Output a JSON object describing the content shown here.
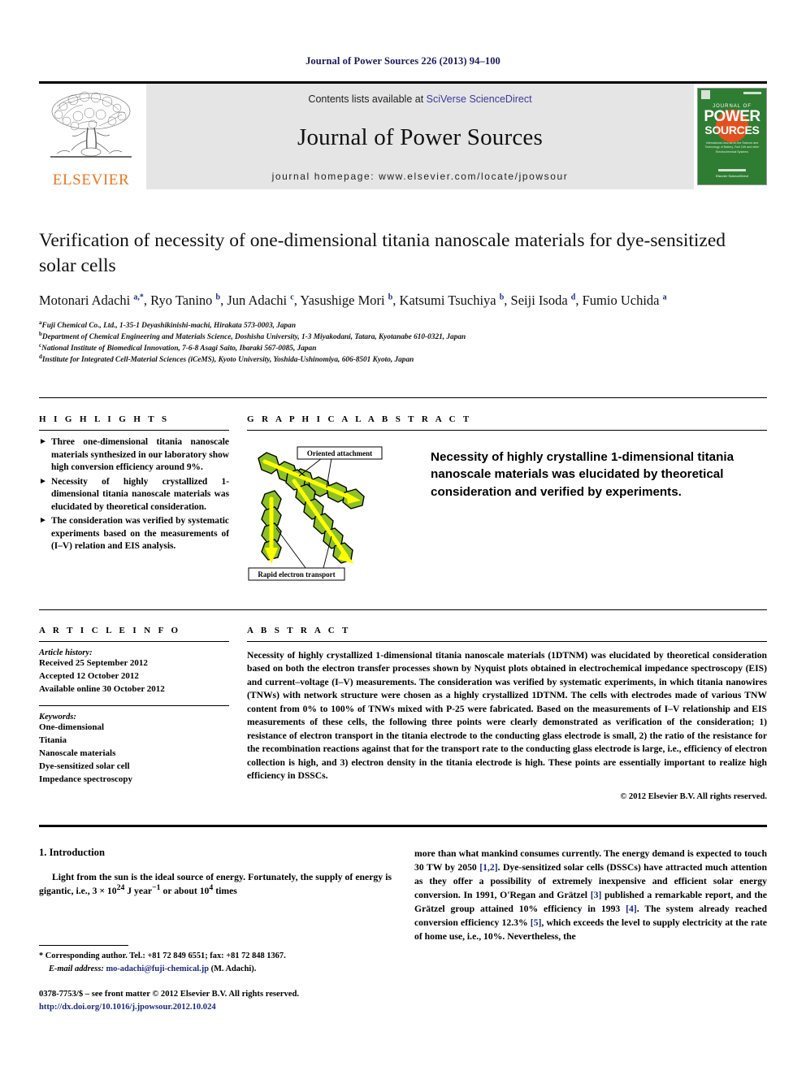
{
  "running_head": "Journal of Power Sources 226 (2013) 94–100",
  "masthead": {
    "publisher_name": "ELSEVIER",
    "contents_prefix": "Contents lists available at ",
    "contents_link": "SciVerse ScienceDirect",
    "journal_title": "Journal of Power Sources",
    "homepage": "journal homepage: www.elsevier.com/locate/jpowsour",
    "cover": {
      "line_journal_of": "JOURNAL OF",
      "line_power": "POWER",
      "line_sources": "SOURCES",
      "subtitle": "International Journal on the Science and Technology of Battery, Fuel Cell and other Electrochemical Systems",
      "footer": "Elsevier ScienceDirect"
    }
  },
  "article": {
    "title": "Verification of necessity of one-dimensional titania nanoscale materials for dye-sensitized solar cells",
    "authors_html": "Motonari Adachi <sup>a,*</sup>, Ryo Tanino <sup>b</sup>, Jun Adachi <sup>c</sup>, Yasushige Mori <sup>b</sup>, Katsumi Tsuchiya <sup>b</sup>, Seiji Isoda <sup>d</sup>, Fumio Uchida <sup>a</sup>",
    "affiliations": [
      {
        "mark": "a",
        "text": "Fuji Chemical Co., Ltd., 1-35-1 Deyashikinishi-machi, Hirakata 573-0003, Japan"
      },
      {
        "mark": "b",
        "text": "Department of Chemical Engineering and Materials Science, Doshisha University, 1-3 Miyakodani, Tatara, Kyotanabe 610-0321, Japan"
      },
      {
        "mark": "c",
        "text": "National Institute of Biomedical Innovation, 7-6-8 Asagi Saito, Ibaraki 567-0085, Japan"
      },
      {
        "mark": "d",
        "text": "Institute for Integrated Cell-Material Sciences (iCeMS), Kyoto University, Yoshida-Ushinomiya, 606-8501 Kyoto, Japan"
      }
    ]
  },
  "highlights": {
    "heading": "H I G H L I G H T S",
    "items": [
      "Three one-dimensional titania nanoscale materials synthesized in our laboratory show high conversion efficiency around 9%.",
      "Necessity of highly crystallized 1-dimensional titania nanoscale materials was elucidated by theoretical consideration.",
      "The consideration was verified by systematic experiments based on the measurements of (I–V) relation and EIS analysis."
    ],
    "bullet_glyph": "►"
  },
  "graphical_abstract": {
    "heading": "G R A P H I C A L   A B S T R A C T",
    "figure_labels": {
      "oriented_attachment": "Oriented attachment",
      "rapid_electron_transport": "Rapid electron transport"
    },
    "caption": "Necessity of highly crystalline 1-dimensional titania nanoscale materials was elucidated by theoretical consideration and verified by experiments.",
    "colors": {
      "crystal_fill": "#8CC026",
      "crystal_stroke": "#000000",
      "arrow": "#FFFF00"
    }
  },
  "article_info": {
    "heading": "A R T I C L E   I N F O",
    "history_label": "Article history:",
    "history": [
      "Received 25 September 2012",
      "Accepted 12 October 2012",
      "Available online 30 October 2012"
    ],
    "keywords_label": "Keywords:",
    "keywords": [
      "One-dimensional",
      "Titania",
      "Nanoscale materials",
      "Dye-sensitized solar cell",
      "Impedance spectroscopy"
    ]
  },
  "abstract": {
    "heading": "A B S T R A C T",
    "text": "Necessity of highly crystallized 1-dimensional titania nanoscale materials (1DTNM) was elucidated by theoretical consideration based on both the electron transfer processes shown by Nyquist plots obtained in electrochemical impedance spectroscopy (EIS) and current–voltage (I–V) measurements. The consideration was verified by systematic experiments, in which titania nanowires (TNWs) with network structure were chosen as a highly crystallized 1DTNM. The cells with electrodes made of various TNW content from 0% to 100% of TNWs mixed with P-25 were fabricated. Based on the measurements of I–V relationship and EIS measurements of these cells, the following three points were clearly demonstrated as verification of the consideration; 1) resistance of electron transport in the titania electrode to the conducting glass electrode is small, 2) the ratio of the resistance for the recombination reactions against that for the transport rate to the conducting glass electrode is large, i.e., efficiency of electron collection is high, and 3) electron density in the titania electrode is high. These points are essentially important to realize high efficiency in DSSCs.",
    "copyright": "© 2012 Elsevier B.V. All rights reserved."
  },
  "body": {
    "section_heading": "1. Introduction",
    "left_paragraph_html": "Light from the sun is the ideal source of energy. Fortunately, the supply of energy is gigantic, i.e., 3 × 10<sup>24</sup> J year<sup>−1</sup> or about 10<sup>4</sup> times",
    "right_paragraph_html": "more than what mankind consumes currently. The energy demand is expected to touch 30 TW by 2050 <span class=\"ref\">[1,2]</span>. Dye-sensitized solar cells (DSSCs) have attracted much attention as they offer a possibility of extremely inexpensive and efficient solar energy conversion. In 1991, O'Regan and Grätzel <span class=\"ref\">[3]</span> published a remarkable report, and the Grätzel group attained 10% efficiency in 1993 <span class=\"ref\">[4]</span>. The system already reached conversion efficiency 12.3% <span class=\"ref\">[5]</span>, which exceeds the level to supply electricity at the rate of home use, i.e., 10%. Nevertheless, the"
  },
  "footnote": {
    "corresponding": "* Corresponding author. Tel.: +81 72 849 6551; fax: +81 72 848 1367.",
    "email_label": "E-mail address:",
    "email": "mo-adachi@fuji-chemical.jp",
    "email_suffix": "(M. Adachi).",
    "imprint": "0378-7753/$ – see front matter © 2012 Elsevier B.V. All rights reserved.",
    "doi": "http://dx.doi.org/10.1016/j.jpowsour.2012.10.024"
  }
}
